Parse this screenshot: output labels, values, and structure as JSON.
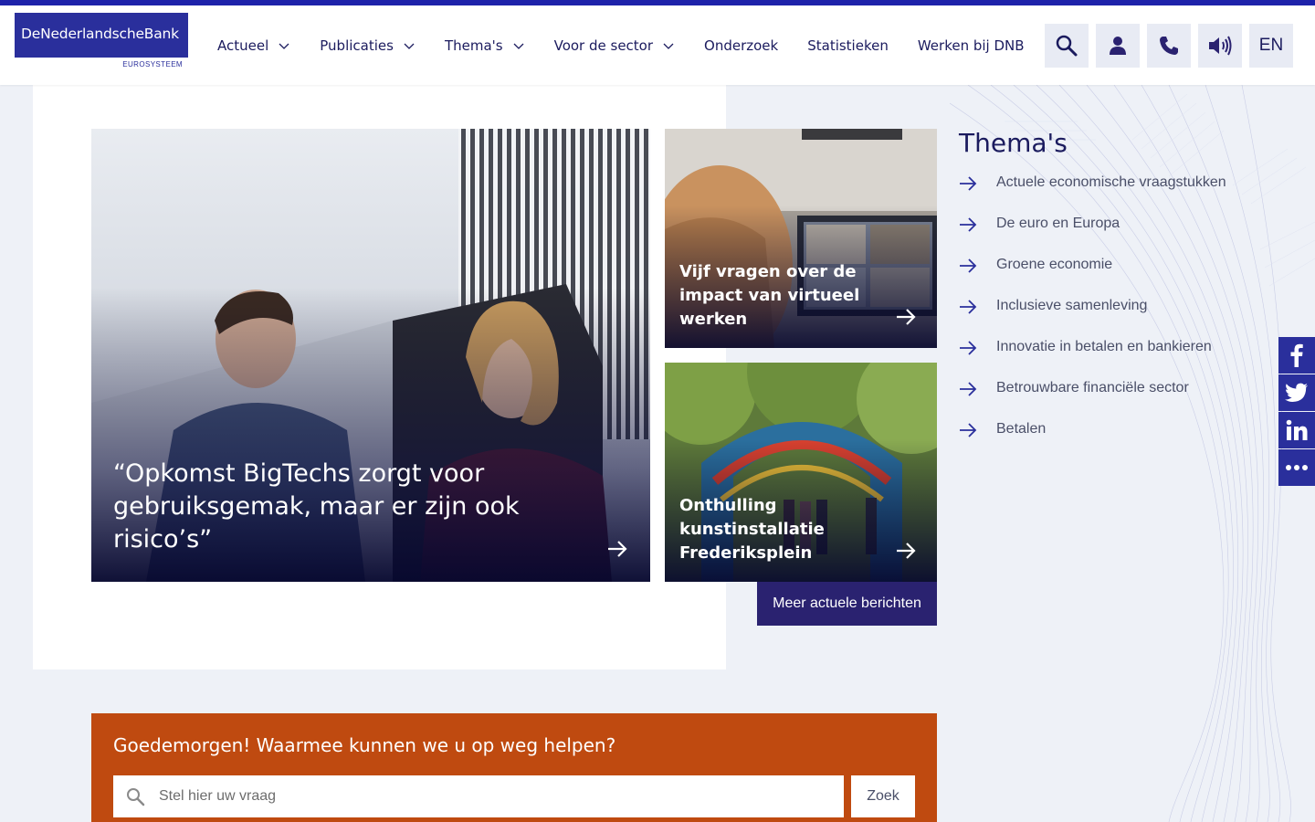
{
  "brand": {
    "name": "DeNederlandscheBank",
    "subtitle": "EUROSYSTEEM",
    "accent_color": "#1e22aa",
    "logo_bg": "#2a2f9c"
  },
  "nav": {
    "items": [
      {
        "label": "Actueel",
        "has_dropdown": true
      },
      {
        "label": "Publicaties",
        "has_dropdown": true
      },
      {
        "label": "Thema's",
        "has_dropdown": true
      },
      {
        "label": "Voor de sector",
        "has_dropdown": true
      },
      {
        "label": "Onderzoek",
        "has_dropdown": false
      },
      {
        "label": "Statistieken",
        "has_dropdown": false
      },
      {
        "label": "Werken bij DNB",
        "has_dropdown": false
      }
    ]
  },
  "utility": {
    "search_icon": "search-icon",
    "login_icon": "user-icon",
    "contact_icon": "phone-icon",
    "readspeaker_icon": "speaker-icon",
    "language_label": "EN"
  },
  "news": {
    "main": {
      "title": "“Opkomst BigTechs zorgt voor gebruiksgemak, maar er zijn ook risico’s”"
    },
    "side": [
      {
        "title": "Vijf vragen over de impact van virtueel werken"
      },
      {
        "title": "Onthulling kunstinstallatie Frederiksplein"
      }
    ],
    "more_label": "Meer actuele berichten"
  },
  "themes": {
    "title": "Thema's",
    "items": [
      "Actuele economische vraagstukken",
      "De euro en Europa",
      "Groene economie",
      "Inclusieve samenleving",
      "Innovatie in betalen en bankieren",
      "Betrouwbare financiële sector",
      "Betalen"
    ]
  },
  "social": {
    "buttons": [
      "facebook-icon",
      "twitter-icon",
      "linkedin-icon",
      "more-icon"
    ],
    "color": "#2a2f9c"
  },
  "help": {
    "title": "Goedemorgen! Waarmee kunnen we u op weg helpen?",
    "input_placeholder": "Stel hier uw vraag",
    "input_value": "",
    "submit_label": "Zoek",
    "bg_color": "#bf4a10"
  }
}
